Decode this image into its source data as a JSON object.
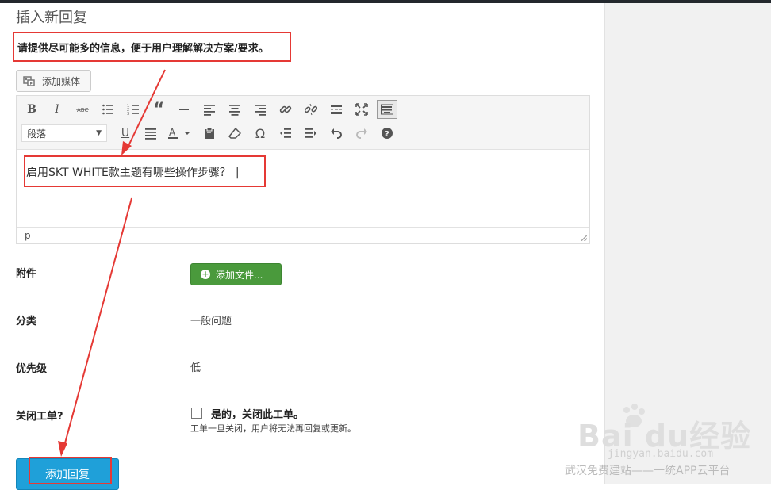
{
  "page": {
    "title": "插入新回复",
    "instruction": "请提供尽可能多的信息，便于用户理解解决方案/要求。"
  },
  "media": {
    "add_media_label": "添加媒体"
  },
  "editor": {
    "format_select": "段落",
    "content": "启用SKT WHITE款主题有哪些操作步骤？",
    "status_path": "p",
    "toolbar_row1": [
      "bold-icon",
      "italic-icon",
      "strikethrough-icon",
      "bullet-list-icon",
      "numbered-list-icon",
      "blockquote-icon",
      "horizontal-rule-icon",
      "align-left-icon",
      "align-center-icon",
      "align-right-icon",
      "link-icon",
      "unlink-icon",
      "read-more-icon",
      "fullscreen-icon",
      "toolbar-toggle-icon"
    ],
    "toolbar_row2": [
      "underline-icon",
      "justify-icon",
      "text-color-icon",
      "paste-text-icon",
      "clear-formatting-icon",
      "special-character-icon",
      "outdent-icon",
      "indent-icon",
      "undo-icon",
      "redo-icon",
      "help-icon"
    ]
  },
  "form": {
    "attachment_label": "附件",
    "add_file_label": "添加文件...",
    "category_label": "分类",
    "category_value": "一般问题",
    "priority_label": "优先级",
    "priority_value": "低",
    "close_ticket_label": "关闭工单?",
    "close_checkbox_label": "是的，关闭此工单。",
    "close_help": "工单一旦关闭，用户将无法再回复或更新。",
    "submit_label": "添加回复"
  },
  "watermark": {
    "logo": "Bai  du经验",
    "url": "jingyan.baidu.com",
    "caption": "武汉免费建站——一统APP云平台"
  },
  "colors": {
    "annotation_red": "#e53935",
    "submit_blue": "#1fa0d9",
    "file_green": "#4a9a3c"
  }
}
